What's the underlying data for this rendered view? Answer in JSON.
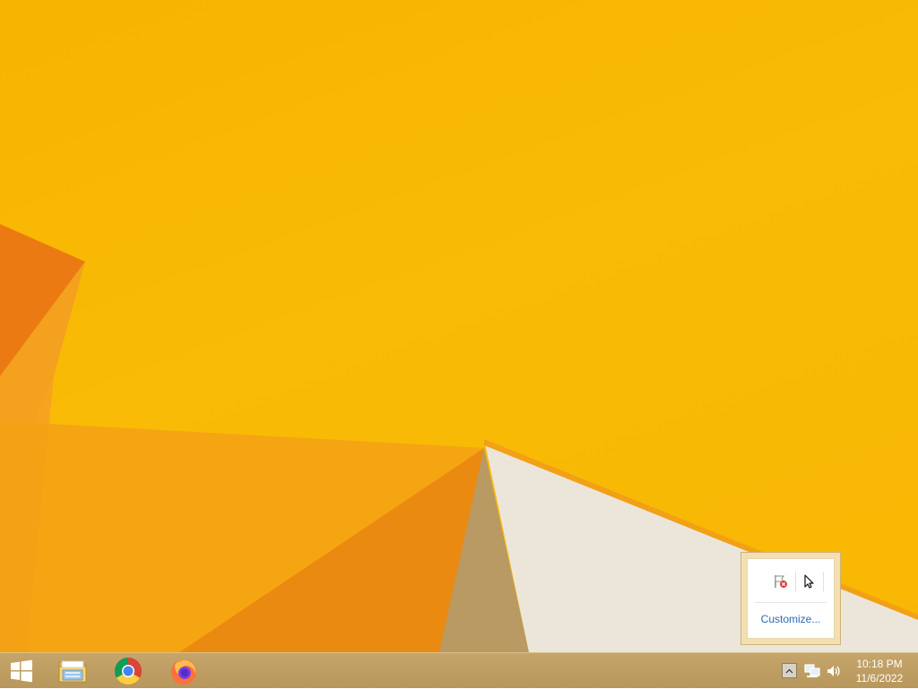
{
  "desktop": {
    "colors": {
      "background": "#f8b704",
      "shape_orange": "#f08a10",
      "shape_white": "#ece6da"
    }
  },
  "taskbar": {
    "pinned": [
      {
        "name": "start",
        "icon": "windows-logo-icon"
      },
      {
        "name": "file-explorer",
        "icon": "folder-icon"
      },
      {
        "name": "chrome",
        "icon": "chrome-icon"
      },
      {
        "name": "firefox",
        "icon": "firefox-icon"
      }
    ],
    "tray": {
      "overflow_icon": "chevron-up-icon",
      "network_icon": "network-icon",
      "volume_icon": "volume-icon",
      "clock": {
        "time": "10:18 PM",
        "date": "11/6/2022"
      }
    }
  },
  "tray_popup": {
    "icons": [
      "action-center-flag-icon",
      "cursor-icon"
    ],
    "customize_label": "Customize..."
  }
}
